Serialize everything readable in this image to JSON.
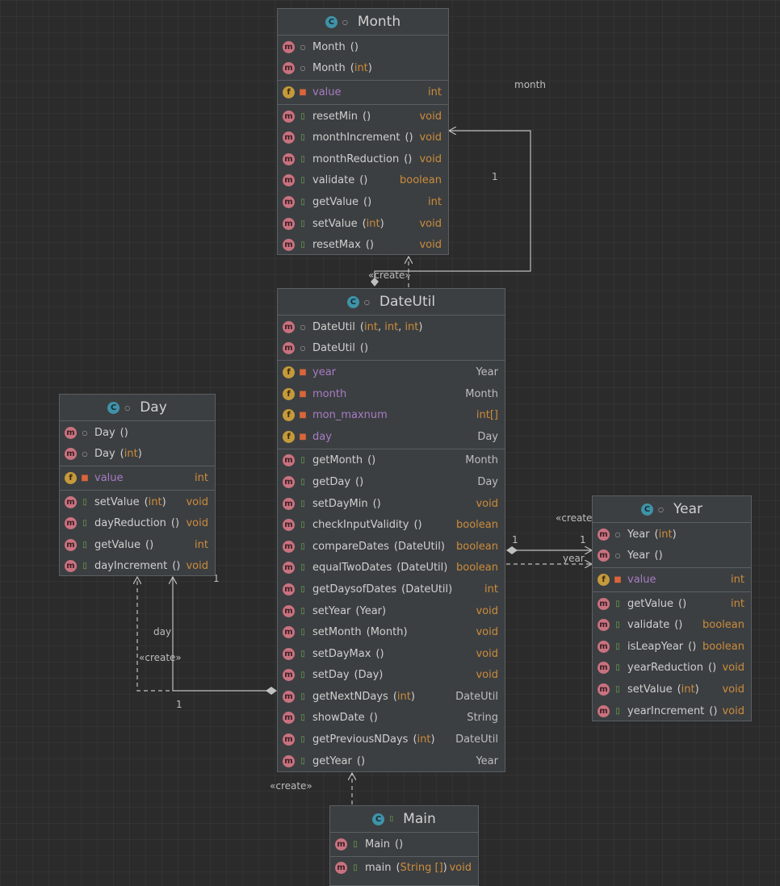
{
  "labels": {
    "create": "«create»",
    "month_role": "month",
    "year_role": "year",
    "day_role": "day",
    "one": "1"
  },
  "classes": {
    "month": {
      "name": "Month",
      "constructors": [
        {
          "name": "Month",
          "args": "()",
          "type": ""
        },
        {
          "name": "Month",
          "args": "(int)",
          "type": ""
        }
      ],
      "fields": [
        {
          "name": "value",
          "type": "int"
        }
      ],
      "methods": [
        {
          "name": "resetMin",
          "args": "()",
          "type": "void"
        },
        {
          "name": "monthIncrement",
          "args": "()",
          "type": "void"
        },
        {
          "name": "monthReduction",
          "args": "()",
          "type": "void"
        },
        {
          "name": "validate",
          "args": "()",
          "type": "boolean"
        },
        {
          "name": "getValue",
          "args": "()",
          "type": "int"
        },
        {
          "name": "setValue",
          "args": "(int)",
          "type": "void"
        },
        {
          "name": "resetMax",
          "args": "()",
          "type": "void"
        }
      ]
    },
    "dateutil": {
      "name": "DateUtil",
      "constructors": [
        {
          "name": "DateUtil",
          "args": "(int, int, int)",
          "type": ""
        },
        {
          "name": "DateUtil",
          "args": "()",
          "type": ""
        }
      ],
      "fields": [
        {
          "name": "year",
          "type": "Year"
        },
        {
          "name": "month",
          "type": "Month"
        },
        {
          "name": "mon_maxnum",
          "type": "int[]"
        },
        {
          "name": "day",
          "type": "Day"
        }
      ],
      "methods": [
        {
          "name": "getMonth",
          "args": "()",
          "type": "Month"
        },
        {
          "name": "getDay",
          "args": "()",
          "type": "Day"
        },
        {
          "name": "setDayMin",
          "args": "()",
          "type": "void"
        },
        {
          "name": "checkInputValidity",
          "args": "()",
          "type": "boolean"
        },
        {
          "name": "compareDates",
          "args": "(DateUtil)",
          "type": "boolean"
        },
        {
          "name": "equalTwoDates",
          "args": "(DateUtil)",
          "type": "boolean"
        },
        {
          "name": "getDaysofDates",
          "args": "(DateUtil)",
          "type": "int"
        },
        {
          "name": "setYear",
          "args": "(Year)",
          "type": "void"
        },
        {
          "name": "setMonth",
          "args": "(Month)",
          "type": "void"
        },
        {
          "name": "setDayMax",
          "args": "()",
          "type": "void"
        },
        {
          "name": "setDay",
          "args": "(Day)",
          "type": "void"
        },
        {
          "name": "getNextNDays",
          "args": "(int)",
          "type": "DateUtil"
        },
        {
          "name": "showDate",
          "args": "()",
          "type": "String"
        },
        {
          "name": "getPreviousNDays",
          "args": "(int)",
          "type": "DateUtil"
        },
        {
          "name": "getYear",
          "args": "()",
          "type": "Year"
        }
      ]
    },
    "day": {
      "name": "Day",
      "constructors": [
        {
          "name": "Day",
          "args": "()",
          "type": ""
        },
        {
          "name": "Day",
          "args": "(int)",
          "type": ""
        }
      ],
      "fields": [
        {
          "name": "value",
          "type": "int"
        }
      ],
      "methods": [
        {
          "name": "setValue",
          "args": "(int)",
          "type": "void"
        },
        {
          "name": "dayReduction",
          "args": "()",
          "type": "void"
        },
        {
          "name": "getValue",
          "args": "()",
          "type": "int"
        },
        {
          "name": "dayIncrement",
          "args": "()",
          "type": "void"
        }
      ]
    },
    "year": {
      "name": "Year",
      "constructors": [
        {
          "name": "Year",
          "args": "(int)",
          "type": ""
        },
        {
          "name": "Year",
          "args": "()",
          "type": ""
        }
      ],
      "fields": [
        {
          "name": "value",
          "type": "int"
        }
      ],
      "methods": [
        {
          "name": "getValue",
          "args": "()",
          "type": "int"
        },
        {
          "name": "validate",
          "args": "()",
          "type": "boolean"
        },
        {
          "name": "isLeapYear",
          "args": "()",
          "type": "boolean"
        },
        {
          "name": "yearReduction",
          "args": "()",
          "type": "void"
        },
        {
          "name": "setValue",
          "args": "(int)",
          "type": "void"
        },
        {
          "name": "yearIncrement",
          "args": "()",
          "type": "void"
        }
      ]
    },
    "main": {
      "name": "Main",
      "constructors": [
        {
          "name": "Main",
          "args": "()",
          "type": ""
        }
      ],
      "fields": [],
      "methods": [
        {
          "name": "main",
          "args": "(String [])",
          "type": "void"
        }
      ]
    }
  }
}
